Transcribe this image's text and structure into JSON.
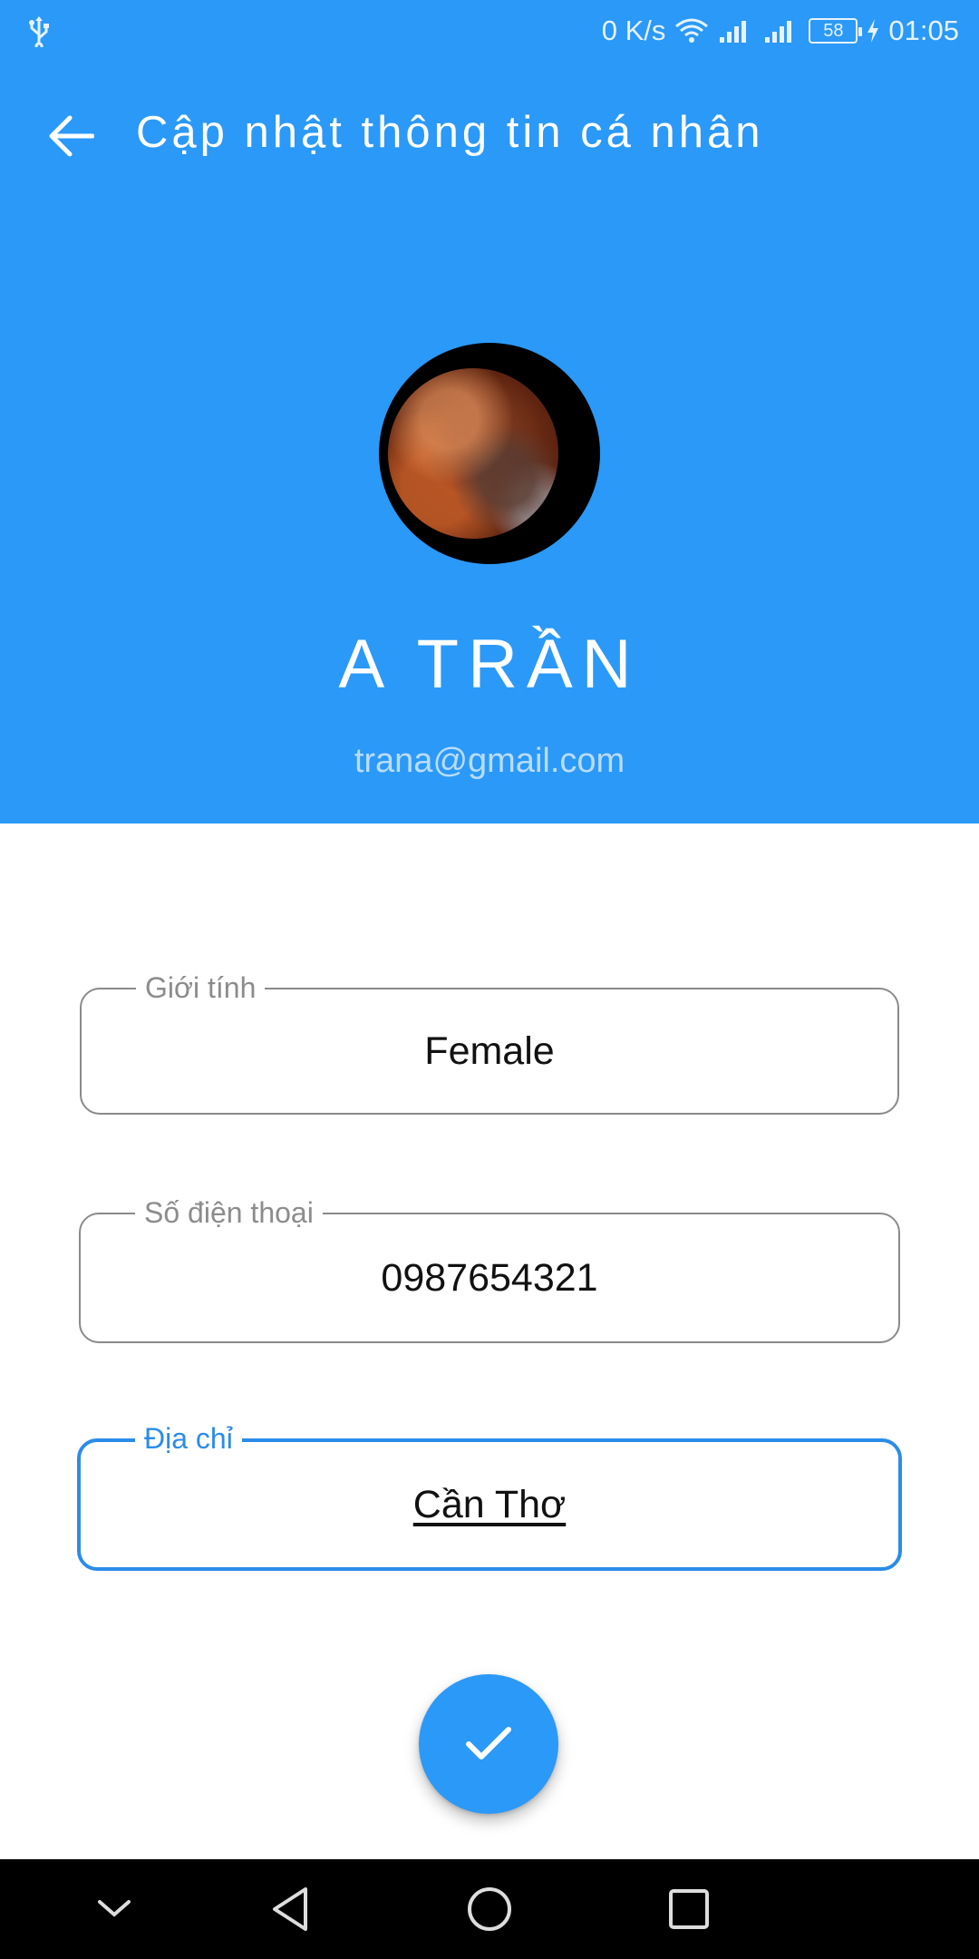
{
  "status_bar": {
    "net_speed": "0 K/s",
    "battery": "58",
    "time": "01:05",
    "icons": [
      "usb-icon",
      "wifi-icon",
      "signal-icon",
      "signal-icon",
      "battery-icon",
      "charging-icon"
    ]
  },
  "app_bar": {
    "title": "Cập nhật thông tin cá nhân",
    "back_icon": "arrow-left-icon"
  },
  "profile": {
    "name": "A TRẦN",
    "email": "trana@gmail.com"
  },
  "form": {
    "fields": [
      {
        "label": "Giới tính",
        "value": "Female",
        "state": "normal"
      },
      {
        "label": "Số điện thoại",
        "value": "0987654321",
        "state": "normal"
      },
      {
        "label": "Địa chỉ",
        "value": "Cần Thơ",
        "state": "focused"
      }
    ]
  },
  "fab": {
    "icon": "check-icon"
  },
  "nav_bar": {
    "icons": [
      "chevron-down-icon",
      "back-triangle-icon",
      "home-circle-icon",
      "recents-square-icon"
    ]
  },
  "colors": {
    "primary": "#2b99f7",
    "focus": "#2b8ce8",
    "outline": "#8a8a8a"
  }
}
